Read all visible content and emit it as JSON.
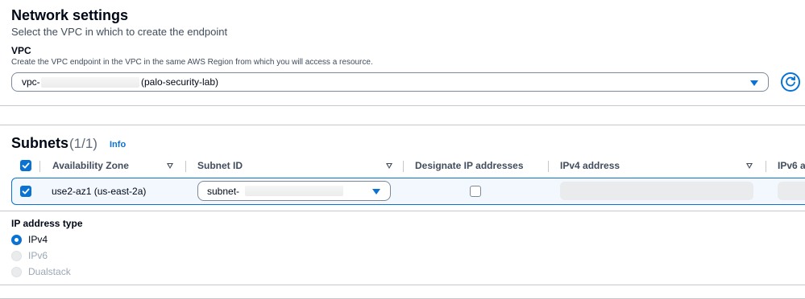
{
  "network": {
    "title": "Network settings",
    "description": "Select the VPC in which to create the endpoint",
    "vpc": {
      "label": "VPC",
      "description": "Create the VPC endpoint in the VPC in the same AWS Region from which you will access a resource.",
      "value_prefix": "vpc-",
      "value_suffix": "(palo-security-lab)",
      "refresh_icon": "refresh-icon"
    }
  },
  "subnets": {
    "title": "Subnets",
    "count": "(1/1)",
    "info": "Info",
    "columns": [
      "Availability Zone",
      "Subnet ID",
      "Designate IP addresses",
      "IPv4 address",
      "IPv6 a"
    ],
    "rows": [
      {
        "selected": true,
        "availability_zone": "use2-az1 (us-east-2a)",
        "subnet_prefix": "subnet-",
        "designate_ip": false
      }
    ]
  },
  "ip_address_type": {
    "label": "IP address type",
    "options": [
      {
        "label": "IPv4",
        "selected": true,
        "disabled": false
      },
      {
        "label": "IPv6",
        "selected": false,
        "disabled": true
      },
      {
        "label": "Dualstack",
        "selected": false,
        "disabled": true
      }
    ]
  },
  "colors": {
    "accent": "#0972d3",
    "text": "#000716",
    "secondary_text": "#414d5c",
    "disabled": "#9ba7b6"
  }
}
